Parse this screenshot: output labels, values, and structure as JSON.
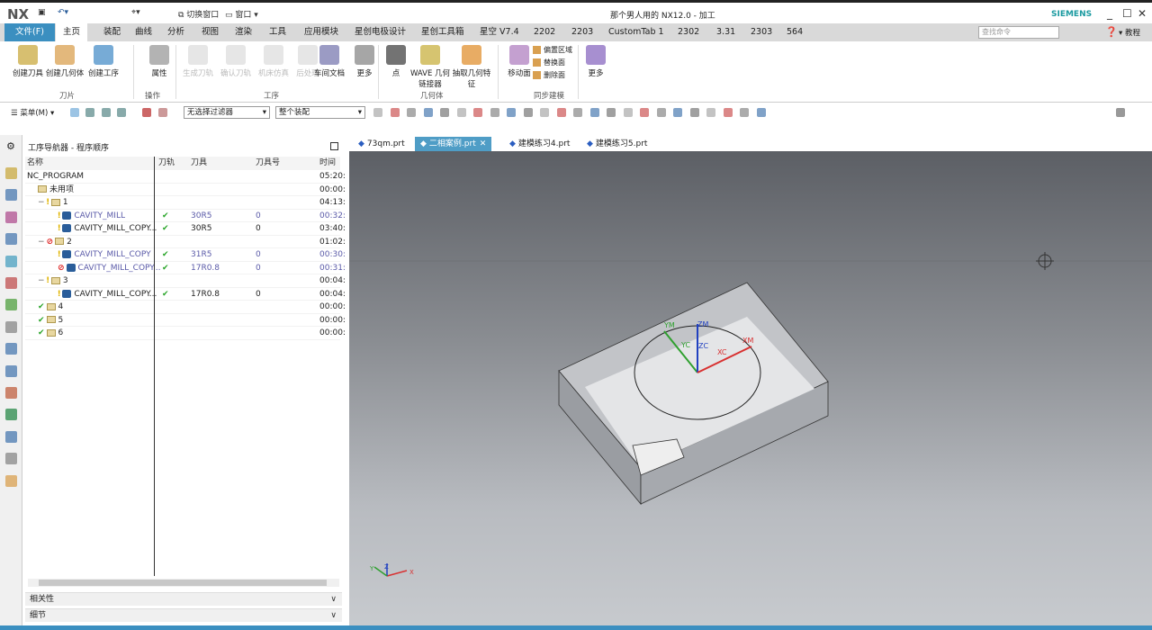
{
  "titlebar": {
    "logo": "NX",
    "switch_window": "切换窗口",
    "window": "窗口",
    "title": "那个男人用的 NX12.0 - 加工",
    "brand": "SIEMENS"
  },
  "menu": {
    "file": "文件(F)",
    "tabs": [
      "主页",
      "装配",
      "曲线",
      "分析",
      "视图",
      "渲染",
      "工具",
      "应用模块",
      "星创电极设计",
      "星创工具箱",
      "星空 V7.4",
      "2202",
      "2203",
      "CustomTab 1",
      "2302",
      "3.31",
      "2303",
      "564"
    ],
    "active": "主页",
    "search_placeholder": "查找命令",
    "help": "教程"
  },
  "ribbon": {
    "buttons": [
      {
        "label": "创建刀具",
        "enabled": true
      },
      {
        "label": "创建几何体",
        "enabled": true
      },
      {
        "label": "创建工序",
        "enabled": true
      },
      {
        "label": "属性",
        "enabled": true
      },
      {
        "label": "生成刀轨",
        "enabled": false
      },
      {
        "label": "确认刀轨",
        "enabled": false
      },
      {
        "label": "机床仿真",
        "enabled": false
      },
      {
        "label": "后处理",
        "enabled": false
      },
      {
        "label": "车间文档",
        "enabled": true
      },
      {
        "label": "更多",
        "enabled": true
      },
      {
        "label": "点",
        "enabled": true
      },
      {
        "label": "WAVE 几何链接器",
        "enabled": true
      },
      {
        "label": "抽取几何特征",
        "enabled": true
      },
      {
        "label": "移动面",
        "enabled": true
      },
      {
        "label": "更多",
        "enabled": true
      }
    ],
    "small_buttons": [
      "偏置区域",
      "替换面",
      "删除面"
    ],
    "groups": [
      "刀片",
      "操作",
      "工序",
      "几何体",
      "同步建模"
    ]
  },
  "toolbar": {
    "menu": "菜单(M)",
    "filter": "无选择过滤器",
    "scope": "整个装配"
  },
  "navigator": {
    "title": "工序导航器 - 程序顺序",
    "columns": [
      "名称",
      "刀轨",
      "刀具",
      "刀具号",
      "时间"
    ],
    "rows": [
      {
        "name": "NC_PROGRAM",
        "level": 0,
        "status": "",
        "kind": "root",
        "path": "",
        "tool": "",
        "toolnum": "",
        "time": "05:20:",
        "blue": false
      },
      {
        "name": "未用项",
        "level": 1,
        "status": "",
        "kind": "group",
        "path": "",
        "tool": "",
        "toolnum": "",
        "time": "00:00:",
        "blue": false
      },
      {
        "name": "1",
        "level": 1,
        "status": "regen",
        "kind": "group",
        "path": "",
        "tool": "",
        "toolnum": "",
        "time": "04:13:",
        "blue": false
      },
      {
        "name": "CAVITY_MILL",
        "level": 2,
        "status": "regen",
        "kind": "op",
        "path": "✔",
        "tool": "30R5",
        "toolnum": "0",
        "time": "00:32:",
        "blue": true
      },
      {
        "name": "CAVITY_MILL_COPY...",
        "level": 2,
        "status": "regen",
        "kind": "op",
        "path": "✔",
        "tool": "30R5",
        "toolnum": "0",
        "time": "03:40:",
        "blue": false
      },
      {
        "name": "2",
        "level": 1,
        "status": "blocked",
        "kind": "group",
        "path": "",
        "tool": "",
        "toolnum": "",
        "time": "01:02:",
        "blue": false
      },
      {
        "name": "CAVITY_MILL_COPY",
        "level": 2,
        "status": "regen",
        "kind": "op",
        "path": "✔",
        "tool": "31R5",
        "toolnum": "0",
        "time": "00:30:",
        "blue": true
      },
      {
        "name": "CAVITY_MILL_COPY...",
        "level": 2,
        "status": "blocked",
        "kind": "op",
        "path": "✔",
        "tool": "17R0.8",
        "toolnum": "0",
        "time": "00:31:",
        "blue": true
      },
      {
        "name": "3",
        "level": 1,
        "status": "regen",
        "kind": "group",
        "path": "",
        "tool": "",
        "toolnum": "",
        "time": "00:04:",
        "blue": false
      },
      {
        "name": "CAVITY_MILL_COPY...",
        "level": 2,
        "status": "regen",
        "kind": "op",
        "path": "✔",
        "tool": "17R0.8",
        "toolnum": "0",
        "time": "00:04:",
        "blue": false
      },
      {
        "name": "4",
        "level": 1,
        "status": "done",
        "kind": "group",
        "path": "",
        "tool": "",
        "toolnum": "",
        "time": "00:00:",
        "blue": false
      },
      {
        "name": "5",
        "level": 1,
        "status": "done",
        "kind": "group",
        "path": "",
        "tool": "",
        "toolnum": "",
        "time": "00:00:",
        "blue": false
      },
      {
        "name": "6",
        "level": 1,
        "status": "done",
        "kind": "group",
        "path": "",
        "tool": "",
        "toolnum": "",
        "time": "00:00:",
        "blue": false
      }
    ],
    "sections": [
      "相关性",
      "细节"
    ]
  },
  "file_tabs": [
    {
      "label": "73qm.prt",
      "active": false
    },
    {
      "label": "二相案例.prt",
      "active": true
    },
    {
      "label": "建模练习4.prt",
      "active": false
    },
    {
      "label": "建模练习5.prt",
      "active": false
    }
  ],
  "viewport": {
    "axes": {
      "ym": "YM",
      "yc": "YC",
      "zm": "ZM",
      "zc": "ZC",
      "xc": "XC",
      "xm": "XM"
    },
    "triad": {
      "x": "X",
      "y": "Y",
      "z": "Z"
    }
  },
  "colors": {
    "accent": "#3b8fc0",
    "x_axis": "#d83030",
    "y_axis": "#2fa02f",
    "z_axis": "#2040c0"
  }
}
